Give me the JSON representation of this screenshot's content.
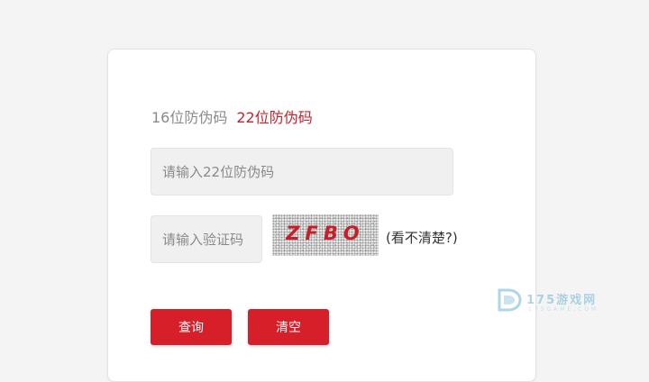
{
  "tabs": {
    "tab16_label": "16位防伪码",
    "tab22_label": "22位防伪码"
  },
  "code_input": {
    "placeholder": "请输入22位防伪码",
    "value": ""
  },
  "captcha": {
    "input_placeholder": "请输入验证码",
    "input_value": "",
    "image_text": "ZFBO",
    "refresh_label": "(看不清楚?)"
  },
  "buttons": {
    "query_label": "查询",
    "clear_label": "清空"
  },
  "watermark": {
    "text": "175游戏网",
    "subtext": "175GAME.COM"
  },
  "colors": {
    "accent": "#d71f2a",
    "active_tab": "#c8222c",
    "inactive_tab": "#8a8a8a",
    "page_bg": "#f4f4f4"
  },
  "icons": {
    "watermark_logo": "175-logo-icon"
  }
}
